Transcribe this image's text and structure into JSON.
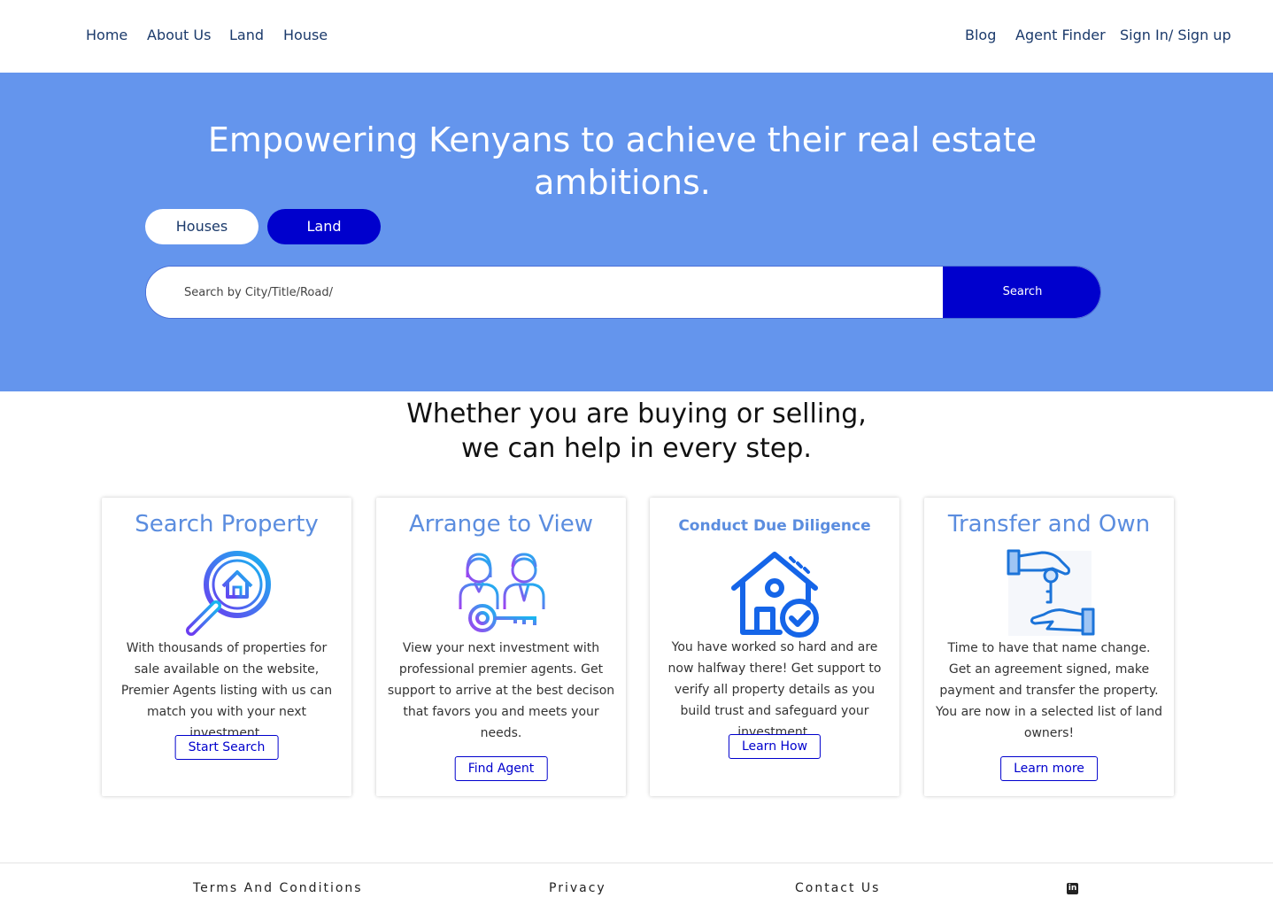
{
  "nav": {
    "left": [
      {
        "label": "Home"
      },
      {
        "label": "About Us"
      },
      {
        "label": "Land"
      },
      {
        "label": "House"
      }
    ],
    "right": [
      {
        "label": "Blog"
      },
      {
        "label": "Agent Finder"
      },
      {
        "label": "Sign In/ Sign up"
      }
    ]
  },
  "hero": {
    "title": "Empowering Kenyans to achieve their real estate ambitions.",
    "toggle": {
      "houses": "Houses",
      "land": "Land",
      "selected": "Land"
    },
    "search": {
      "placeholder": "Search by City/Title/Road/",
      "button": "Search"
    },
    "background": "#6495ed",
    "accent": "#0000cd"
  },
  "help": {
    "heading_line1": "Whether you are buying or selling,",
    "heading_line2": "we can help in every step."
  },
  "cards": [
    {
      "title": "Search Property",
      "icon": "magnifier-house-icon",
      "text": "With thousands of  properties for sale available on the website, Premier Agents listing with us can match you with your next investment.",
      "button": "Start Search"
    },
    {
      "title": "Arrange to View",
      "icon": "agents-key-icon",
      "text": "View your next investment with professional premier agents. Get support to arrive at the best decison that favors you and meets your needs.",
      "button": "Find Agent"
    },
    {
      "title": "Conduct Due Diligence",
      "icon": "house-check-icon",
      "text": "You have worked so hard and are now halfway there! Get support to verify all property details as you build trust and safeguard your investment.",
      "button": "Learn How"
    },
    {
      "title": "Transfer and Own",
      "icon": "hand-key-icon",
      "text": "Time to  have that name change. Get an agreement signed, make payment and transfer the property. You are now in a selected list of land owners!",
      "button": "Learn more"
    }
  ],
  "footer": {
    "terms": "Terms And Conditions",
    "privacy": "Privacy",
    "contact": "Contact Us",
    "social_icon": "linkedin-icon",
    "linkedin_text": "in"
  }
}
